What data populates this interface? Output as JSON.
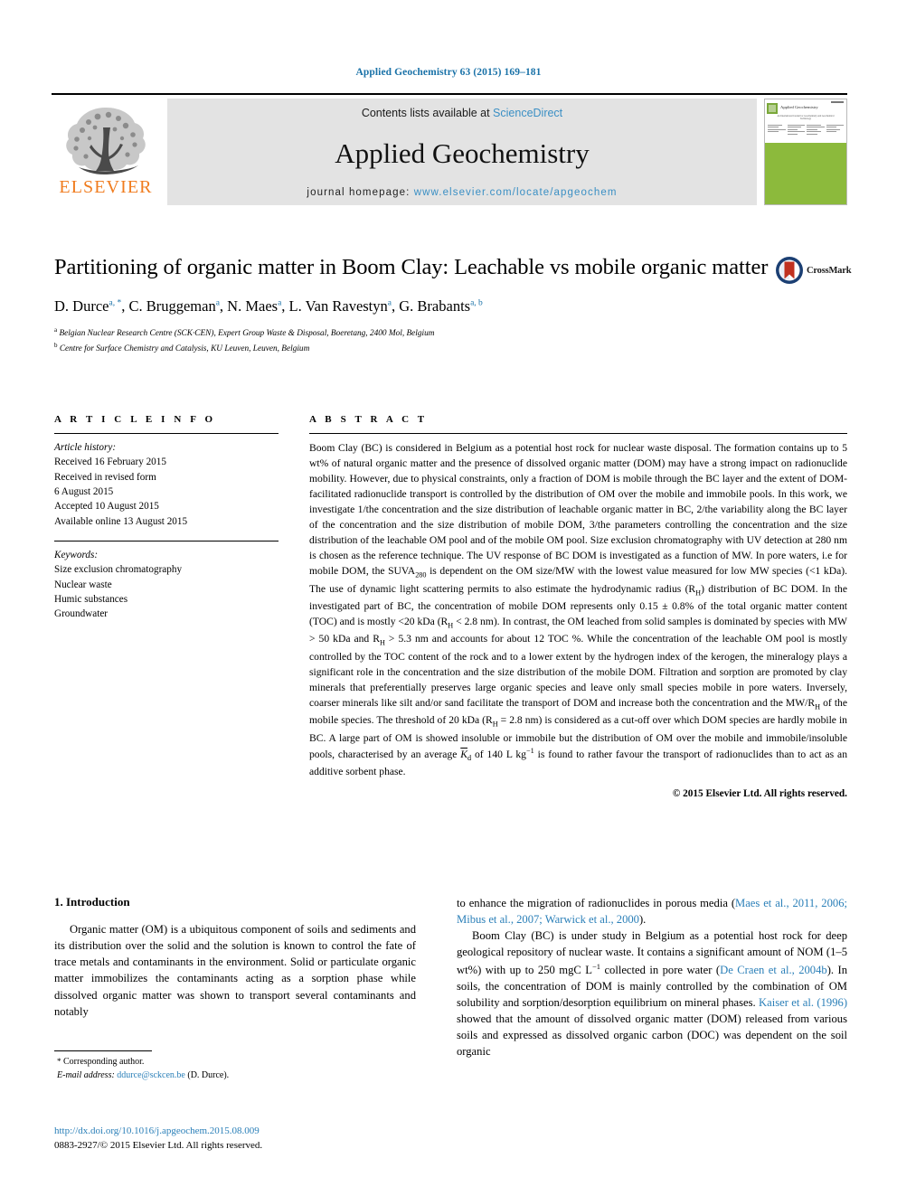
{
  "running_head": "Applied Geochemistry 63 (2015) 169–181",
  "masthead": {
    "contents_prefix": "Contents lists available at ",
    "contents_link": "ScienceDirect",
    "journal_title": "Applied Geochemistry",
    "homepage_prefix": "journal homepage: ",
    "homepage_url": "www.elsevier.com/locate/apgeochem",
    "publisher": "ELSEVIER",
    "cover": {
      "title": "Applied Geochemistry",
      "subtitle": "An International Journal for Geochemistry and Geochemical Technology",
      "green": "#8CBA3C"
    }
  },
  "article": {
    "title": "Partitioning of organic matter in Boom Clay: Leachable vs mobile organic matter",
    "authors": [
      {
        "name": "D. Durce",
        "marks": "a, *"
      },
      {
        "name": "C. Bruggeman",
        "marks": "a"
      },
      {
        "name": "N. Maes",
        "marks": "a"
      },
      {
        "name": "L. Van Ravestyn",
        "marks": "a"
      },
      {
        "name": "G. Brabants",
        "marks": "a, b"
      }
    ],
    "affiliations": [
      {
        "mark": "a",
        "text": "Belgian Nuclear Research Centre (SCK·CEN), Expert Group Waste & Disposal, Boeretang, 2400 Mol, Belgium"
      },
      {
        "mark": "b",
        "text": "Centre for Surface Chemistry and Catalysis, KU Leuven, Leuven, Belgium"
      }
    ],
    "crossmark_label": "CrossMark"
  },
  "article_info": {
    "heading": "A R T I C L E   I N F O",
    "history_label": "Article history:",
    "history": [
      "Received 16 February 2015",
      "Received in revised form",
      "6 August 2015",
      "Accepted 10 August 2015",
      "Available online 13 August 2015"
    ],
    "keywords_label": "Keywords:",
    "keywords": [
      "Size exclusion chromatography",
      "Nuclear waste",
      "Humic substances",
      "Groundwater"
    ]
  },
  "abstract": {
    "heading": "A B S T R A C T",
    "copyright": "© 2015 Elsevier Ltd. All rights reserved."
  },
  "introduction": {
    "heading": "1. Introduction",
    "left_paragraph": "Organic matter (OM) is a ubiquitous component of soils and sediments and its distribution over the solid and the solution is known to control the fate of trace metals and contaminants in the environment. Solid or particulate organic matter immobilizes the contaminants acting as a sorption phase while dissolved organic matter was shown to transport several contaminants and notably",
    "right_cont_prefix": "to enhance the migration of radionuclides in porous media (",
    "right_cont_refs": "Maes et al., 2011, 2006; Mibus et al., 2007; Warwick et al., 2000",
    "right_cont_suffix": ").",
    "right_p2_a": "Boom Clay (BC) is under study in Belgium as a potential host rock for deep geological repository of nuclear waste. It contains a significant amount of NOM (1–5 wt%) with up to 250 mgC L",
    "right_p2_sup": "−1",
    "right_p2_b": " collected in pore water (",
    "right_p2_ref1": "De Craen et al., 2004b",
    "right_p2_c": "). In soils, the concentration of DOM is mainly controlled by the combination of OM solubility and sorption/desorption equilibrium on mineral phases. ",
    "right_p2_ref2": "Kaiser et al. (1996)",
    "right_p2_d": " showed that the amount of dissolved organic matter (DOM) released from various soils and expressed as dissolved organic carbon (DOC) was dependent on the soil organic"
  },
  "footnote": {
    "corresponding": "Corresponding author.",
    "email_label": "E-mail address:",
    "email": "ddurce@sckcen.be",
    "email_owner": "(D. Durce).",
    "doi": "http://dx.doi.org/10.1016/j.apgeochem.2015.08.009",
    "issn_line": "0883-2927/© 2015 Elsevier Ltd. All rights reserved."
  }
}
